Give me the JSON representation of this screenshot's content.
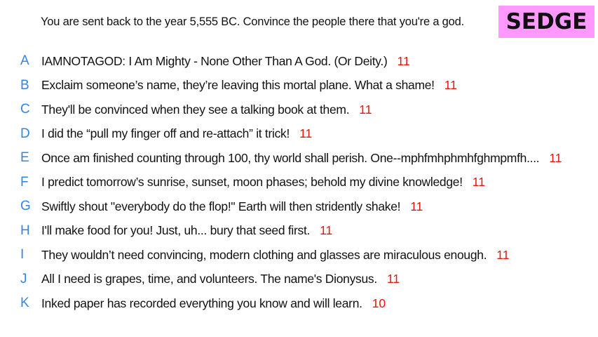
{
  "prompt": "You are sent back to the year 5,555 BC. Convince the people there that you're a god.",
  "badge": {
    "label": "SEDGE",
    "color": "#ff99ff"
  },
  "colors": {
    "letter": "#2f86e8",
    "score": "#e8160c",
    "text": "#111111"
  },
  "answers": [
    {
      "letter": "A",
      "text": "IAMNOTAGOD: I Am Mighty - None Other Than A God. (Or Deity.)",
      "score": "11"
    },
    {
      "letter": "B",
      "text": "Exclaim someone’s name, they’re leaving this mortal plane. What a shame!",
      "score": "11"
    },
    {
      "letter": "C",
      "text": "They'll be convinced when they see a talking book at them.",
      "score": "11"
    },
    {
      "letter": "D",
      "text": "I did the “pull my finger off and re-attach” it trick!",
      "score": "11"
    },
    {
      "letter": "E",
      "text": "Once am finished counting through 100, thy world shall perish. One--mphfmhphmhfghmpmfh....",
      "score": "11"
    },
    {
      "letter": "F",
      "text": "I predict tomorrow’s sunrise, sunset, moon phases; behold my divine knowledge!",
      "score": "11"
    },
    {
      "letter": "G",
      "text": "Swiftly shout \"everybody do the flop!\" Earth will then stridently shake!",
      "score": "11"
    },
    {
      "letter": "H",
      "text": "I'll make food for you! Just, uh... bury that seed first.",
      "score": "11"
    },
    {
      "letter": "I",
      "text": "They wouldn’t need convincing, modern clothing and glasses are miraculous enough.",
      "score": "11"
    },
    {
      "letter": "J",
      "text": "All I need is grapes, time, and volunteers. The name's Dionysus.",
      "score": "11"
    },
    {
      "letter": "K",
      "text": "Inked paper has recorded everything you know and will learn.",
      "score": "10"
    }
  ]
}
